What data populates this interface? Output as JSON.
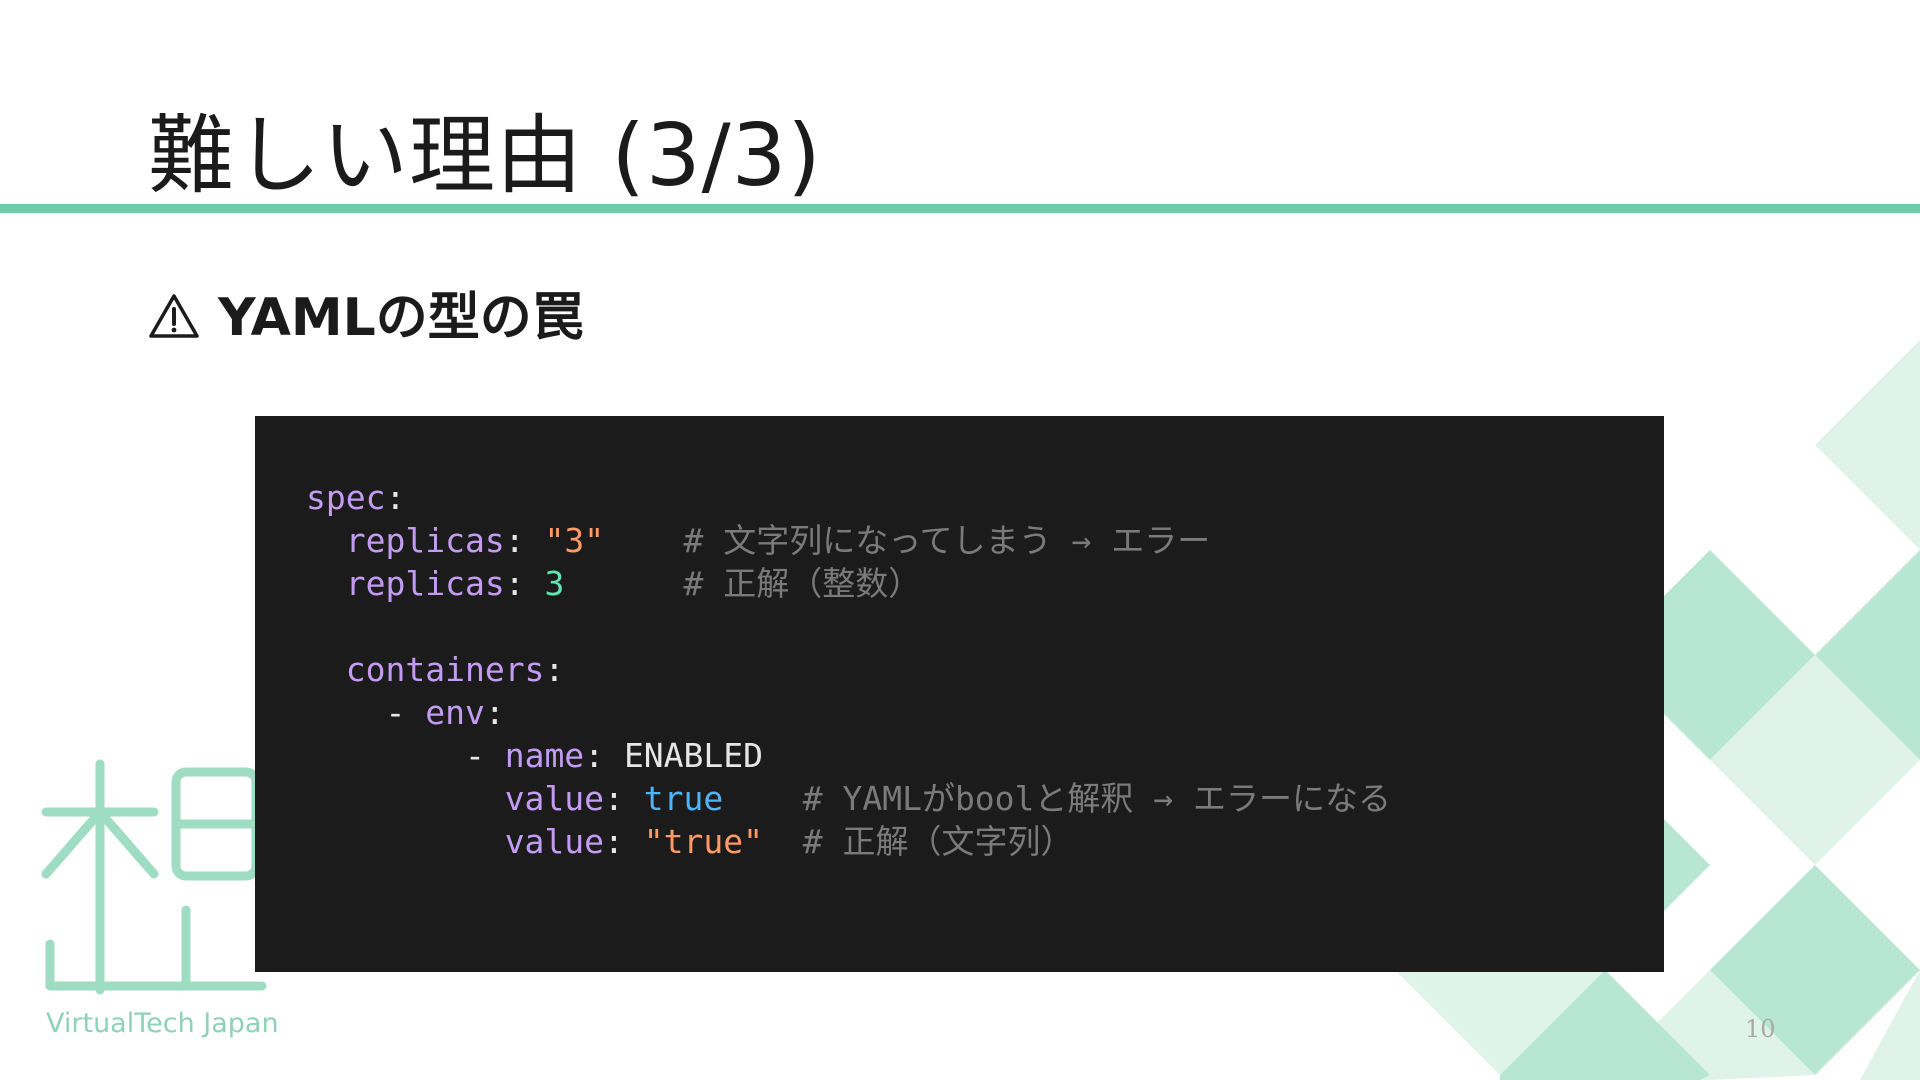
{
  "slide": {
    "title": "難しい理由 (3/3)",
    "heading_icon": "warning-icon",
    "heading": "YAMLの型の罠",
    "page_number": "10"
  },
  "logo": {
    "icon": "virtualtech-logo-icon",
    "text": "VirtualTech Japan"
  },
  "code": {
    "language": "yaml",
    "lines": [
      {
        "indent": "",
        "parts": [
          {
            "t": "spec",
            "cls": "k"
          },
          {
            "t": ":",
            "cls": "p"
          }
        ]
      },
      {
        "indent": "  ",
        "parts": [
          {
            "t": "replicas",
            "cls": "k"
          },
          {
            "t": ": ",
            "cls": "p"
          },
          {
            "t": "\"3\"",
            "cls": "s"
          },
          {
            "t": "    # 文字列になってしまう → エラー",
            "cls": "c"
          }
        ]
      },
      {
        "indent": "  ",
        "parts": [
          {
            "t": "replicas",
            "cls": "k"
          },
          {
            "t": ": ",
            "cls": "p"
          },
          {
            "t": "3",
            "cls": "n"
          },
          {
            "t": "      # 正解（整数）",
            "cls": "c"
          }
        ]
      },
      {
        "indent": "",
        "parts": []
      },
      {
        "indent": "  ",
        "parts": [
          {
            "t": "containers",
            "cls": "k"
          },
          {
            "t": ":",
            "cls": "p"
          }
        ]
      },
      {
        "indent": "    ",
        "parts": [
          {
            "t": "- ",
            "cls": "p"
          },
          {
            "t": "env",
            "cls": "k"
          },
          {
            "t": ":",
            "cls": "p"
          }
        ]
      },
      {
        "indent": "        ",
        "parts": [
          {
            "t": "- ",
            "cls": "p"
          },
          {
            "t": "name",
            "cls": "k"
          },
          {
            "t": ": ",
            "cls": "p"
          },
          {
            "t": "ENABLED",
            "cls": "p"
          }
        ]
      },
      {
        "indent": "          ",
        "parts": [
          {
            "t": "value",
            "cls": "k"
          },
          {
            "t": ": ",
            "cls": "p"
          },
          {
            "t": "true",
            "cls": "b"
          },
          {
            "t": "    # YAMLがboolと解釈 → エラーになる",
            "cls": "c"
          }
        ]
      },
      {
        "indent": "          ",
        "parts": [
          {
            "t": "value",
            "cls": "k"
          },
          {
            "t": ": ",
            "cls": "p"
          },
          {
            "t": "\"true\"",
            "cls": "s"
          },
          {
            "t": "  # 正解（文字列）",
            "cls": "c"
          }
        ]
      }
    ]
  },
  "colors": {
    "accent": "#6fcca8",
    "code_background": "#1b1b1b",
    "code_key": "#c39bf2",
    "code_string": "#ff9a66",
    "code_number": "#5ee6b4",
    "code_bool": "#4fb3f5",
    "code_comment": "#7a7a7a"
  }
}
